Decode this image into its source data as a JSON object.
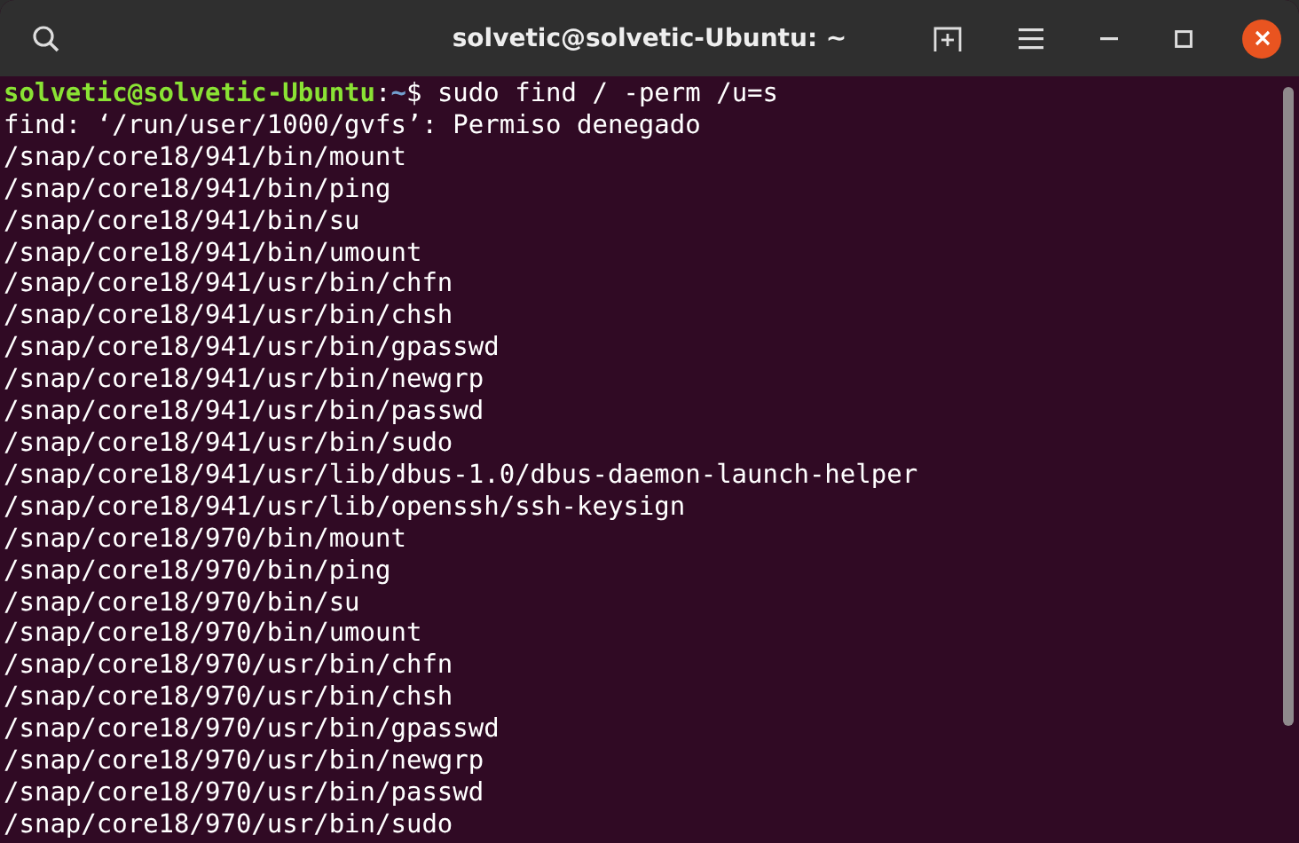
{
  "window": {
    "title": "solvetic@solvetic-Ubuntu: ~"
  },
  "terminal": {
    "lines": [
      {
        "kind": "prompt",
        "user_host": "solvetic@solvetic-Ubuntu",
        "separator": ":",
        "path": "~",
        "symbol": "$",
        "command": "sudo find / -perm /u=s"
      },
      {
        "kind": "output",
        "text": "find: ‘/run/user/1000/gvfs’: Permiso denegado"
      },
      {
        "kind": "output",
        "text": "/snap/core18/941/bin/mount"
      },
      {
        "kind": "output",
        "text": "/snap/core18/941/bin/ping"
      },
      {
        "kind": "output",
        "text": "/snap/core18/941/bin/su"
      },
      {
        "kind": "output",
        "text": "/snap/core18/941/bin/umount"
      },
      {
        "kind": "output",
        "text": "/snap/core18/941/usr/bin/chfn"
      },
      {
        "kind": "output",
        "text": "/snap/core18/941/usr/bin/chsh"
      },
      {
        "kind": "output",
        "text": "/snap/core18/941/usr/bin/gpasswd"
      },
      {
        "kind": "output",
        "text": "/snap/core18/941/usr/bin/newgrp"
      },
      {
        "kind": "output",
        "text": "/snap/core18/941/usr/bin/passwd"
      },
      {
        "kind": "output",
        "text": "/snap/core18/941/usr/bin/sudo"
      },
      {
        "kind": "output",
        "text": "/snap/core18/941/usr/lib/dbus-1.0/dbus-daemon-launch-helper"
      },
      {
        "kind": "output",
        "text": "/snap/core18/941/usr/lib/openssh/ssh-keysign"
      },
      {
        "kind": "output",
        "text": "/snap/core18/970/bin/mount"
      },
      {
        "kind": "output",
        "text": "/snap/core18/970/bin/ping"
      },
      {
        "kind": "output",
        "text": "/snap/core18/970/bin/su"
      },
      {
        "kind": "output",
        "text": "/snap/core18/970/bin/umount"
      },
      {
        "kind": "output",
        "text": "/snap/core18/970/usr/bin/chfn"
      },
      {
        "kind": "output",
        "text": "/snap/core18/970/usr/bin/chsh"
      },
      {
        "kind": "output",
        "text": "/snap/core18/970/usr/bin/gpasswd"
      },
      {
        "kind": "output",
        "text": "/snap/core18/970/usr/bin/newgrp"
      },
      {
        "kind": "output",
        "text": "/snap/core18/970/usr/bin/passwd"
      },
      {
        "kind": "output",
        "text": "/snap/core18/970/usr/bin/sudo"
      }
    ]
  }
}
